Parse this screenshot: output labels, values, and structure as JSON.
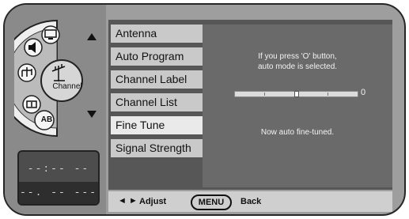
{
  "menu": {
    "items": [
      {
        "label": "Antenna"
      },
      {
        "label": "Auto Program"
      },
      {
        "label": "Channel Label"
      },
      {
        "label": "Channel List"
      },
      {
        "label": "Fine Tune"
      },
      {
        "label": "Signal Strength"
      }
    ],
    "selected_index": 4
  },
  "panel": {
    "instruction_line1": "If you press 'O' button,",
    "instruction_line2": "auto mode is selected.",
    "slider_value": "0",
    "slider_level": 0.5,
    "status": "Now auto fine-tuned."
  },
  "wheel": {
    "center_label": "Channel",
    "ab_label": "AB",
    "icons": [
      "speaker-icon",
      "monitor-icon",
      "antenna-icon",
      "timer-icon",
      "ab-icon"
    ]
  },
  "clock": {
    "time": "--:-- --",
    "date": "--. -- ----"
  },
  "footer": {
    "arrows": "◄ ►",
    "adjust": "Adjust",
    "menu": "MENU",
    "back": "Back"
  }
}
